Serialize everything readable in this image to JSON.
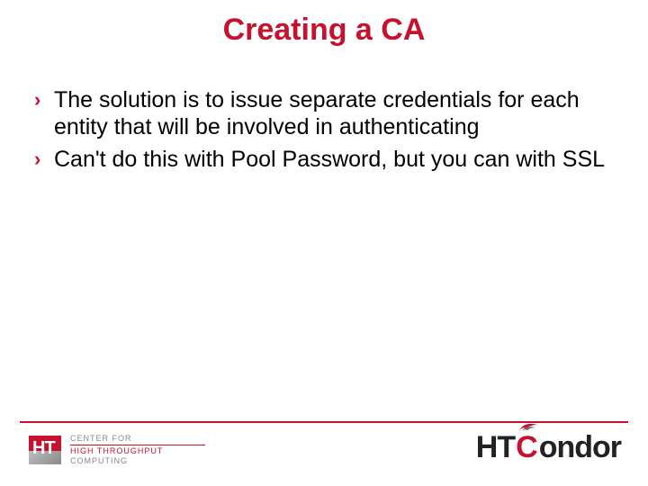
{
  "title": "Creating a CA",
  "bullets": [
    "The solution is to issue separate credentials for each entity that will be involved in authenticating",
    "Can't do this with Pool Password, but you can with SSL"
  ],
  "footer": {
    "left_logo": {
      "mark_text": "HT",
      "line1_prefix": "CENTER FOR",
      "line2_emph": "HIGH THROUGHPUT",
      "line3": "COMPUTING"
    },
    "right_logo": {
      "part1": "HT",
      "part2": "C",
      "part3": "ondor"
    }
  },
  "colors": {
    "accent": "#c4122f"
  }
}
